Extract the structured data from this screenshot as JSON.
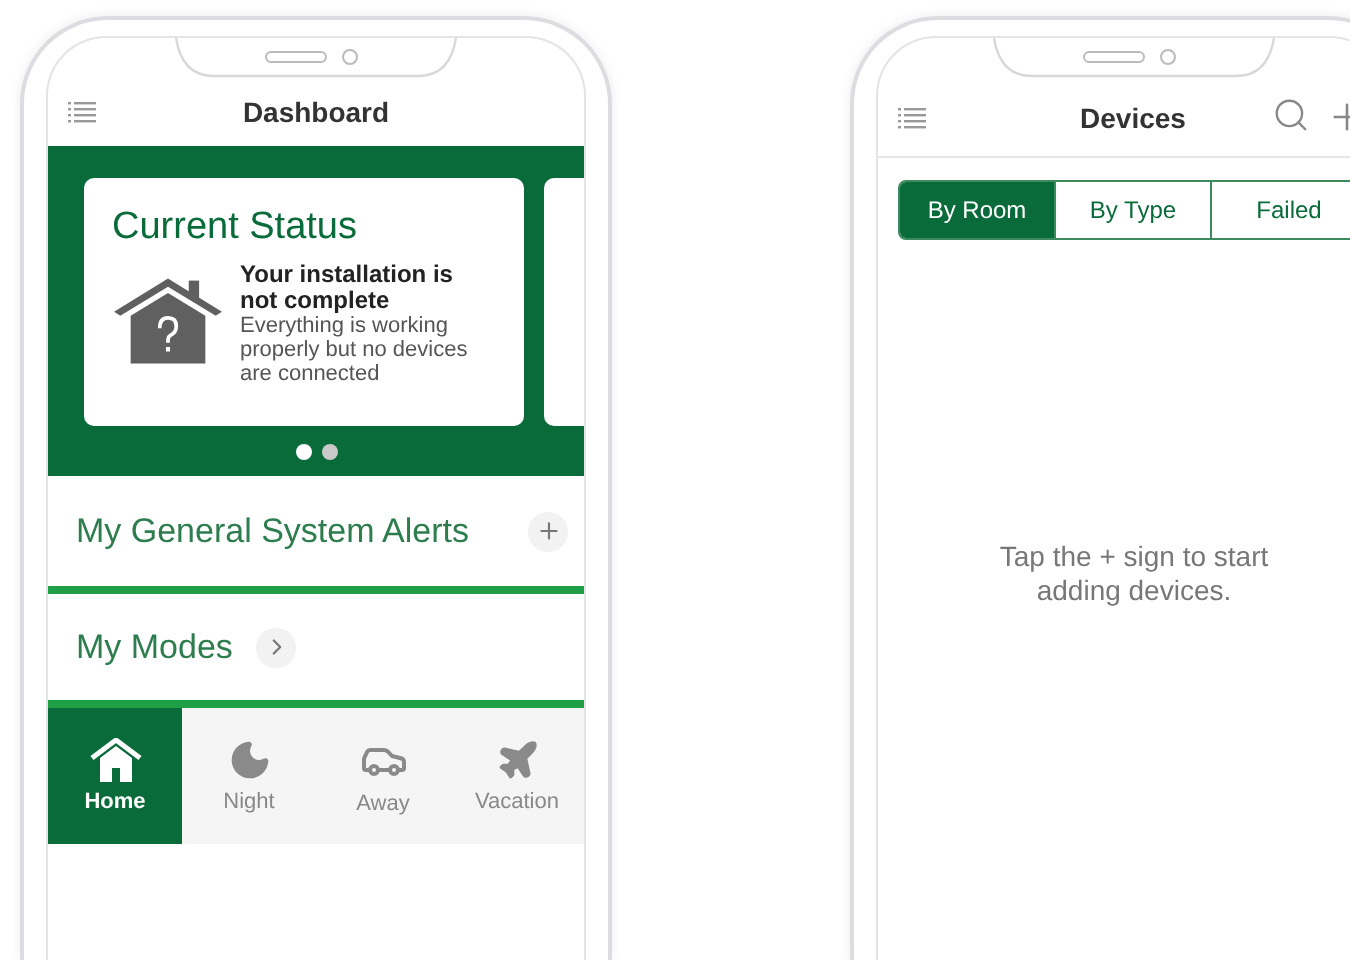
{
  "dashboard": {
    "title": "Dashboard",
    "status_card": {
      "title": "Current Status",
      "headline": "Your installation is not complete",
      "message": "Everything is working properly but no devices are connected"
    },
    "carousel_dots": [
      {
        "selected": true
      },
      {
        "selected": false
      }
    ],
    "sections": [
      {
        "title": "My General System Alerts",
        "kind": "add"
      },
      {
        "title": "My Modes",
        "kind": "open"
      }
    ],
    "modes": [
      {
        "label": "Home",
        "kind": "home",
        "selected": true
      },
      {
        "label": "Night",
        "kind": "night",
        "selected": false
      },
      {
        "label": "Away",
        "kind": "away",
        "selected": false
      },
      {
        "label": "Vacation",
        "kind": "vacation",
        "selected": false
      }
    ]
  },
  "devices": {
    "title": "Devices",
    "filters": [
      {
        "label": "By Room",
        "selected": true
      },
      {
        "label": "By Type",
        "selected": false
      },
      {
        "label": "Failed",
        "selected": false
      }
    ],
    "empty_message": "Tap the + sign to start adding devices."
  }
}
